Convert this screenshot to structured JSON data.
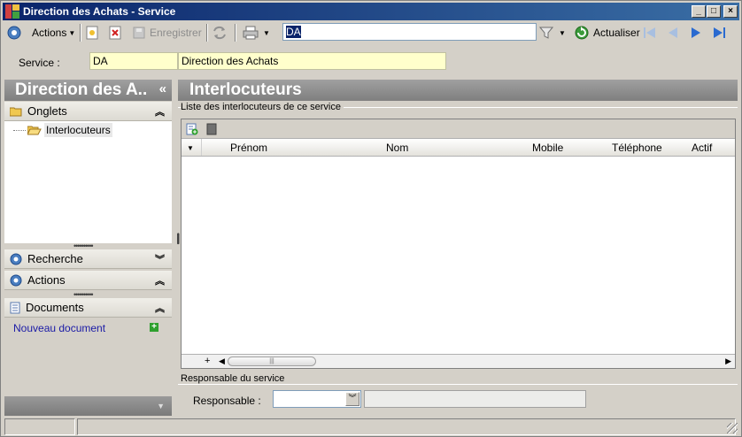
{
  "window": {
    "title": "Direction des Achats -  Service"
  },
  "toolbar": {
    "actions_label": "Actions",
    "save_label": "Enregistrer",
    "search_value": "DA",
    "refresh_label": "Actualiser"
  },
  "service": {
    "label": "Service :",
    "code": "DA",
    "name": "Direction des Achats"
  },
  "left_panel": {
    "header": "Direction des A..",
    "collapse_glyph": "«",
    "sections": {
      "tabs": "Onglets",
      "search": "Recherche",
      "actions": "Actions",
      "documents": "Documents"
    },
    "tree_items": [
      "Interlocuteurs"
    ],
    "new_document_link": "Nouveau document"
  },
  "right_panel": {
    "header": "Interlocuteurs",
    "group_title": "Liste des interlocuteurs de ce service",
    "columns": [
      "Prénom",
      "Nom",
      "Mobile",
      "Téléphone",
      "Actif"
    ],
    "rows": [],
    "responsable_group": "Responsable du service",
    "responsable_label": "Responsable :"
  },
  "colors": {
    "title_bar": "#0a246a",
    "panel_header": "#8a8a8a",
    "highlight_field": "#ffffcc",
    "link": "#1a1aa6"
  }
}
